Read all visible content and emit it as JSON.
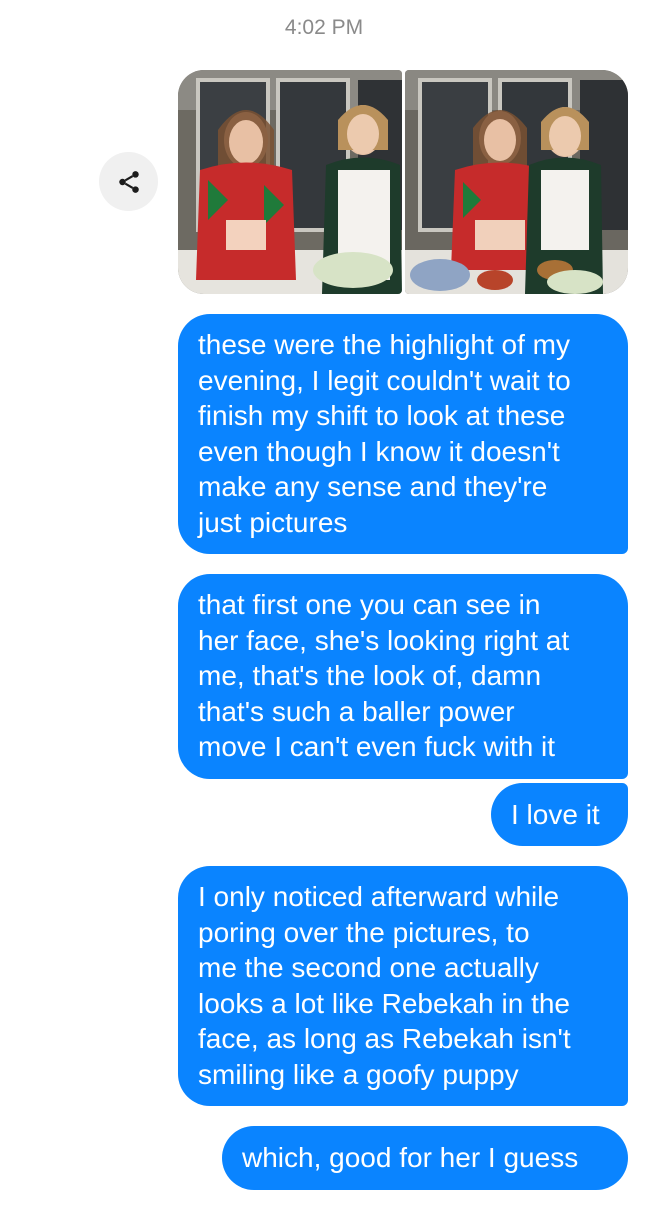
{
  "conversation": {
    "timestamp": "4:02 PM",
    "share_icon": "share-icon",
    "photos": [
      {
        "alt": "photo-1"
      },
      {
        "alt": "photo-2"
      }
    ],
    "messages": [
      {
        "text": "these were the highlight of my\nevening, I legit couldn't wait to\nfinish my shift to look at these\neven though I know it doesn't\nmake any sense and they're\njust pictures"
      },
      {
        "text": "that first one you can see in\nher face, she's looking right at\nme, that's the look of, damn\nthat's such a baller power\nmove I can't even fuck with it"
      },
      {
        "text": "I love it"
      },
      {
        "text": "I only noticed afterward while\nporing over the pictures, to\nme the second one actually\nlooks a lot like Rebekah in the\nface, as long as Rebekah isn't\nsmiling like a goofy puppy"
      },
      {
        "text": "which, good for her I guess"
      }
    ]
  },
  "colors": {
    "bubble": "#0a84ff",
    "timestamp": "#8a8a8a",
    "share_bg": "#f0f0f0"
  }
}
